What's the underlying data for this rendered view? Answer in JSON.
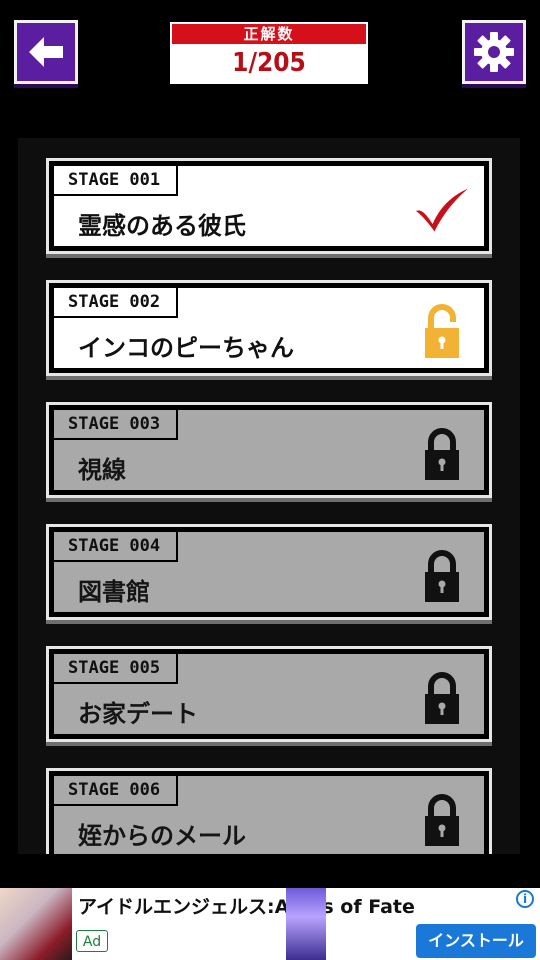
{
  "header": {
    "back_icon": "arrow-left-icon",
    "settings_icon": "gear-icon",
    "score_label": "正解数",
    "score_value": "1/205"
  },
  "stages": [
    {
      "tag": "STAGE 001",
      "title": "霊感のある彼氏",
      "state": "cleared",
      "icon": "check-icon"
    },
    {
      "tag": "STAGE 002",
      "title": "インコのピーちゃん",
      "state": "unlocked",
      "icon": "unlocked-padlock-icon"
    },
    {
      "tag": "STAGE 003",
      "title": "視線",
      "state": "locked",
      "icon": "padlock-icon"
    },
    {
      "tag": "STAGE 004",
      "title": "図書館",
      "state": "locked",
      "icon": "padlock-icon"
    },
    {
      "tag": "STAGE 005",
      "title": "お家デート",
      "state": "locked",
      "icon": "padlock-icon"
    },
    {
      "tag": "STAGE 006",
      "title": "姪からのメール",
      "state": "locked",
      "icon": "padlock-icon"
    }
  ],
  "ad": {
    "title": "アイドルエンジェルス:Aegis of Fate",
    "badge": "Ad",
    "info": "i",
    "install_label": "インストール"
  },
  "colors": {
    "button_purple": "#5b1ea0",
    "score_red": "#d6101a",
    "check_red": "#c8101a",
    "unlock_gold": "#f2b233",
    "locked_gray": "#a9a9a9",
    "install_blue": "#1a79d8"
  }
}
